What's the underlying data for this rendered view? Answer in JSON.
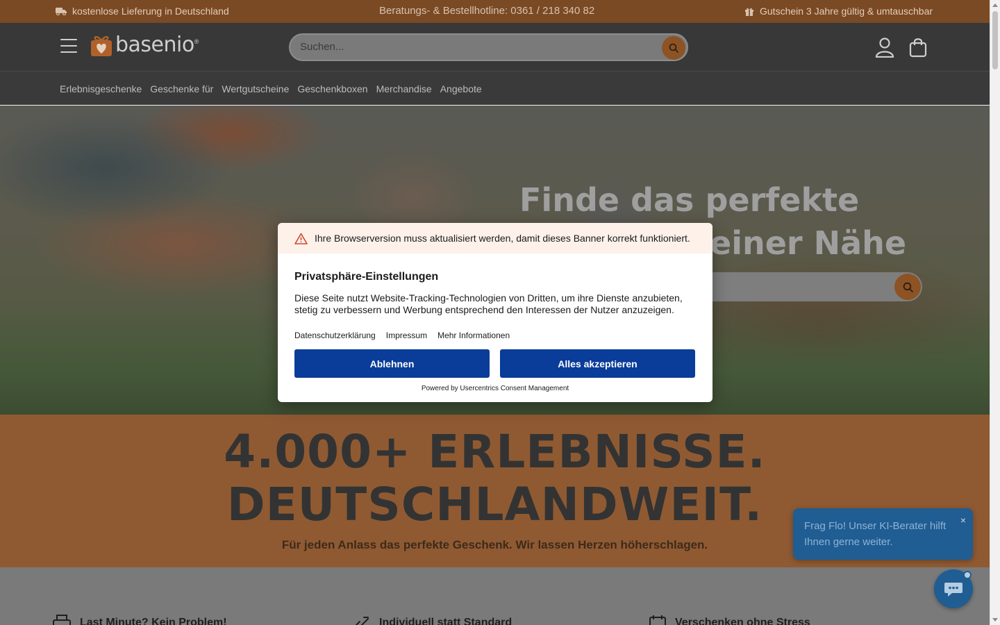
{
  "topbar": {
    "delivery": "kostenlose Lieferung in Deutschland",
    "hotline": "Beratungs- & Bestellhotline: 0361 / 218 340 82",
    "voucher": "Gutschein 3 Jahre gültig & umtauschbar"
  },
  "header": {
    "logo_text": "basenio",
    "logo_mark": "®",
    "search_placeholder": "Suchen..."
  },
  "nav": {
    "items": [
      "Erlebnisgeschenke",
      "Geschenke für",
      "Wertgutscheine",
      "Geschenkboxen",
      "Merchandise",
      "Angebote"
    ]
  },
  "hero": {
    "headline_line1": "Finde das perfekte",
    "headline_line2": "einer Nähe"
  },
  "banner": {
    "line1": "4.000+ ERLEBNISSE.",
    "line2": "DEUTSCHLANDWEIT.",
    "subline": "Für jeden Anlass das perfekte Geschenk. Wir lassen Herzen höherschlagen."
  },
  "features": {
    "items": [
      "Last Minute? Kein Problem!",
      "Individuell statt Standard",
      "Verschenken ohne Stress"
    ]
  },
  "chat": {
    "message": "Frag Flo! Unser KI-Berater hilft Ihnen gerne weiter.",
    "close": "×"
  },
  "consent": {
    "warning": "Ihre Browserversion muss aktualisiert werden, damit dieses Banner korrekt funktioniert.",
    "title": "Privatsphäre-Einstellungen",
    "description": "Diese Seite nutzt Website-Tracking-Technologien von Dritten, um ihre Dienste anzubieten, stetig zu verbessern und Werbung entsprechend den Interessen der Nutzer anzuzeigen.",
    "links": [
      "Datenschutzerklärung",
      "Impressum",
      "Mehr Informationen"
    ],
    "deny_label": "Ablehnen",
    "accept_label": "Alles akzeptieren",
    "powered_by": "Powered by Usercentrics Consent Management"
  },
  "colors": {
    "brand_orange": "#e07a2e",
    "consent_button": "#0a3c99",
    "chat_blue": "#1f5d92"
  }
}
